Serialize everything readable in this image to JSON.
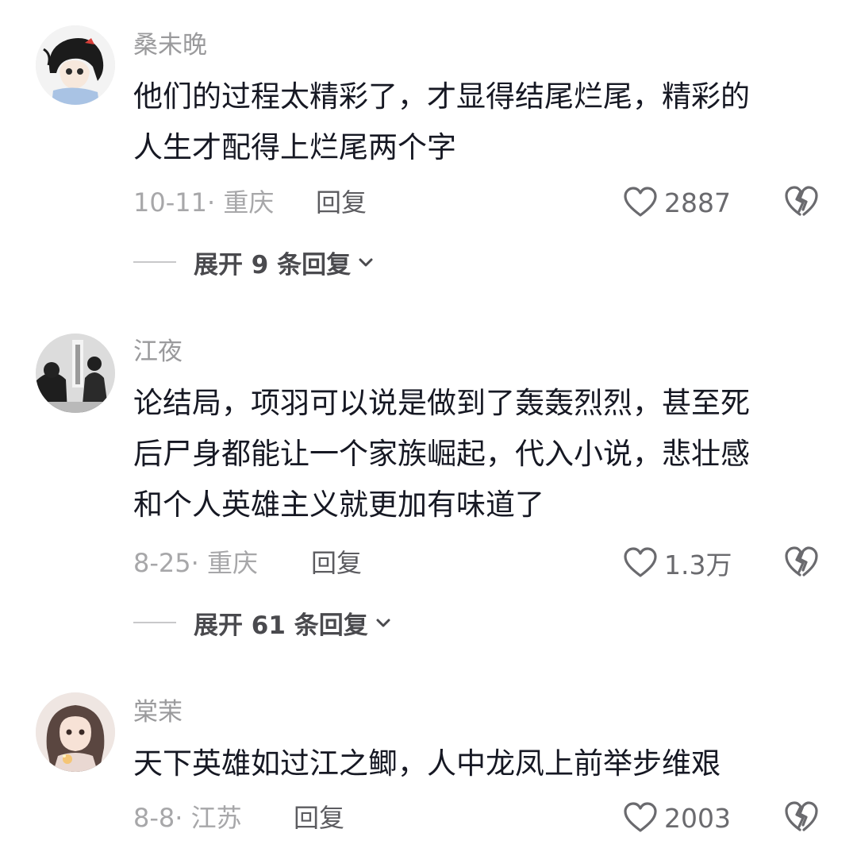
{
  "comments": [
    {
      "username": "桑未晚",
      "lines": [
        "他们的过程太精彩了，才显得结尾烂尾，精彩的",
        "人生才配得上烂尾两个字"
      ],
      "date_location": "10-11· 重庆",
      "reply_label": "回复",
      "likes": "2887",
      "expand_label": "展开 9 条回复"
    },
    {
      "username": "江夜",
      "lines": [
        "论结局，项羽可以说是做到了轰轰烈烈，甚至死",
        "后尸身都能让一个家族崛起，代入小说，悲壮感",
        "和个人英雄主义就更加有味道了"
      ],
      "date_location": "8-25· 重庆",
      "reply_label": "回复",
      "likes": "1.3万",
      "expand_label": "展开 61 条回复"
    },
    {
      "username": "棠茉",
      "lines": [
        "天下英雄如过江之鲫，人中龙凤上前举步维艰"
      ],
      "date_location": "8-8· 江苏",
      "reply_label": "回复",
      "likes": "2003"
    }
  ],
  "icons": {
    "like": "heart-outline-icon",
    "dislike": "broken-heart-icon",
    "expand": "chevron-down-icon"
  },
  "colors": {
    "text": "#161823",
    "username": "#9a9a9c",
    "meta": "#a7a7a9",
    "reply": "#5c5c60",
    "icon": "#6a6a6e"
  }
}
